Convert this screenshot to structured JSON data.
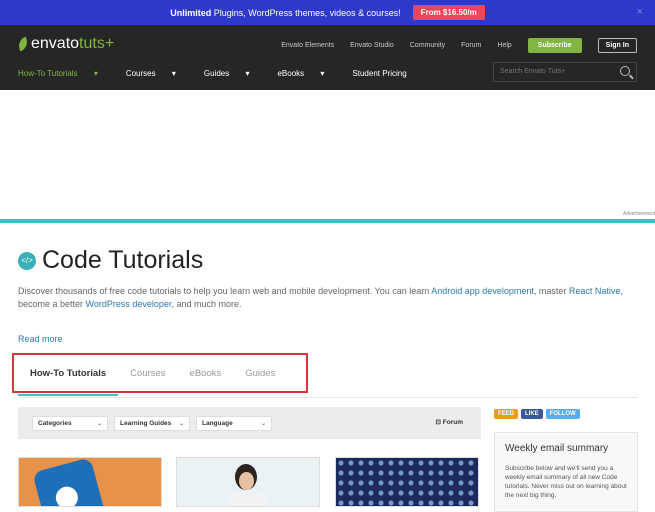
{
  "promo": {
    "bold": "Unlimited",
    "text": " Plugins, WordPress themes, videos & courses!",
    "button": "From $16.50/m",
    "close": "×"
  },
  "header": {
    "logo_main": "envato",
    "logo_sub": "tuts+",
    "links": [
      "Envato Elements",
      "Envato Studio",
      "Community",
      "Forum",
      "Help"
    ],
    "subscribe": "Subscribe",
    "signin": "Sign In",
    "nav": [
      "How-To Tutorials",
      "Courses",
      "Guides",
      "eBooks",
      "Student Pricing"
    ],
    "nav_chevron": "▾",
    "search_placeholder": "Search Envato Tuts+"
  },
  "ad": {
    "label": "Advertisement"
  },
  "page": {
    "icon": "</>",
    "title": "Code Tutorials",
    "desc_1": "Discover thousands of free code tutorials to help you learn web and mobile development. You can learn ",
    "link_1": "Android app development",
    "desc_2": ", master ",
    "link_2": "React Native",
    "desc_3": ", become a better ",
    "link_3": "WordPress developer",
    "desc_4": ", and much more.",
    "read_more": "Read more"
  },
  "tabs": [
    "How-To Tutorials",
    "Courses",
    "eBooks",
    "Guides"
  ],
  "filters": {
    "categories": "Categories",
    "learning_guides": "Learning Guides",
    "language": "Language",
    "forum": "Forum",
    "chevron": "⌄",
    "forum_icon": "⊡"
  },
  "social": {
    "feed": "FEED",
    "like": "LIKE",
    "follow": "FOLLOW"
  },
  "weekly": {
    "title": "Weekly email summary",
    "text": "Subscribe below and we'll send you a weekly email summary of all new Code tutorials. Never miss out on learning about the next big thing."
  },
  "colors": {
    "promo": "#2e38c9",
    "accent": "#82b541",
    "teal": "#44bcc1",
    "highlight": "#d0363c"
  }
}
